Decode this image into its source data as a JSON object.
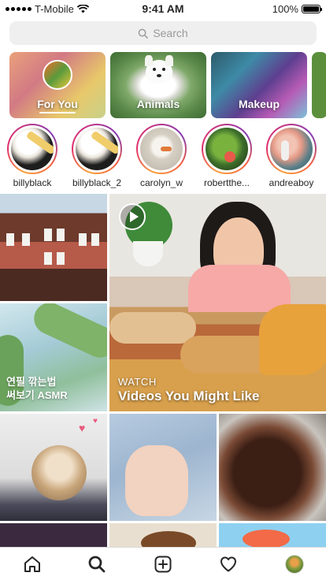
{
  "status_bar": {
    "carrier": "T-Mobile",
    "time": "9:41 AM",
    "battery": "100%",
    "battery_level": 1.0
  },
  "search": {
    "placeholder": "Search"
  },
  "topics": [
    {
      "label": "For You"
    },
    {
      "label": "Animals"
    },
    {
      "label": "Makeup"
    }
  ],
  "stories": [
    {
      "username": "billyblack"
    },
    {
      "username": "billyblack_2"
    },
    {
      "username": "carolyn_w"
    },
    {
      "username": "robertthe..."
    },
    {
      "username": "andreaboy"
    }
  ],
  "featured_video": {
    "kicker": "WATCH",
    "title": "Videos You Might Like"
  },
  "grid_caption_korean": "연필 깎는법\n써보기 ASMR",
  "tab_bar": {
    "icons": [
      "home-icon",
      "search-icon",
      "add-post-icon",
      "heart-icon",
      "profile-avatar"
    ],
    "active": "search-icon"
  }
}
